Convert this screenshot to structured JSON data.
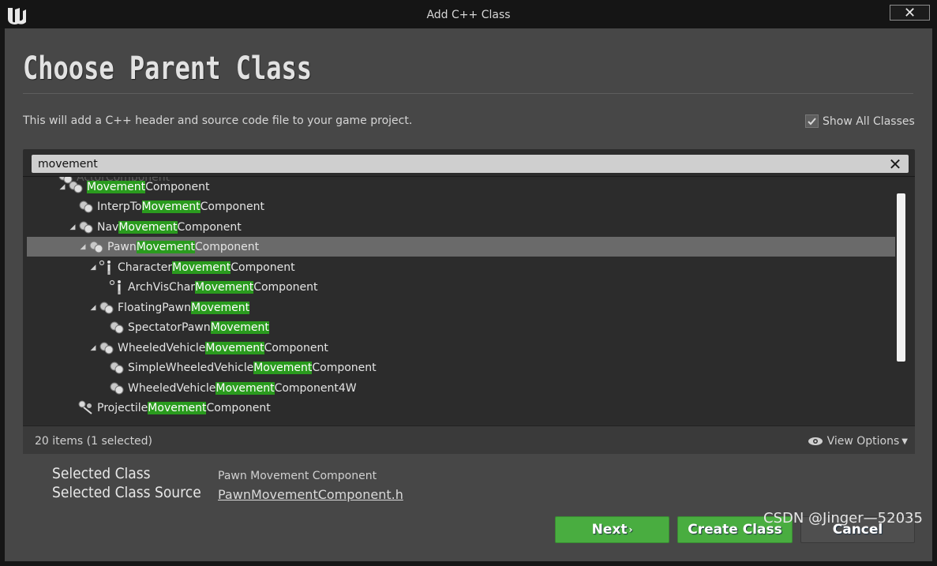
{
  "window": {
    "title": "Add C++ Class",
    "close_glyph": "✕"
  },
  "header": {
    "title": "Choose Parent Class",
    "subtitle": "This will add a C++ header and source code file to your game project.",
    "show_all_label": "Show All Classes",
    "show_all_checked": true
  },
  "search": {
    "value": "movement",
    "clear_glyph": "✕"
  },
  "tree": {
    "rows": [
      {
        "pre": "ActorComponent",
        "hl": "",
        "post": "",
        "icon": "component-icon",
        "expander": "none"
      },
      {
        "pre": "",
        "hl": "Movement",
        "post": "Component",
        "icon": "component-icon",
        "expander": "expanded"
      },
      {
        "pre": "InterpTo",
        "hl": "Movement",
        "post": "Component",
        "icon": "component-icon",
        "expander": "none"
      },
      {
        "pre": "Nav",
        "hl": "Movement",
        "post": "Component",
        "icon": "component-icon",
        "expander": "expanded"
      },
      {
        "pre": "Pawn",
        "hl": "Movement",
        "post": "Component",
        "icon": "component-icon",
        "expander": "expanded",
        "selected": true
      },
      {
        "pre": "Character",
        "hl": "Movement",
        "post": "Component",
        "icon": "character-icon",
        "expander": "expanded"
      },
      {
        "pre": "ArchVisChar",
        "hl": "Movement",
        "post": "Component",
        "icon": "character-icon",
        "expander": "none"
      },
      {
        "pre": "FloatingPawn",
        "hl": "Movement",
        "post": "",
        "icon": "component-icon",
        "expander": "expanded"
      },
      {
        "pre": "SpectatorPawn",
        "hl": "Movement",
        "post": "",
        "icon": "component-icon",
        "expander": "none"
      },
      {
        "pre": "WheeledVehicle",
        "hl": "Movement",
        "post": "Component",
        "icon": "component-icon",
        "expander": "expanded"
      },
      {
        "pre": "SimpleWheeledVehicle",
        "hl": "Movement",
        "post": "Component",
        "icon": "component-icon",
        "expander": "none"
      },
      {
        "pre": "WheeledVehicle",
        "hl": "Movement",
        "post": "Component4W",
        "icon": "component-icon",
        "expander": "none"
      },
      {
        "pre": "Projectile",
        "hl": "Movement",
        "post": "Component",
        "icon": "projectile-icon",
        "expander": "none"
      }
    ]
  },
  "footer": {
    "count": "20 items (1 selected)",
    "view_options": "View Options"
  },
  "selection": {
    "class_label": "Selected Class",
    "class_value": "Pawn Movement Component",
    "source_label": "Selected Class Source",
    "source_value": "PawnMovementComponent.h"
  },
  "buttons": {
    "next": "Next",
    "create": "Create Class",
    "cancel": "Cancel"
  },
  "watermark": "CSDN @Jinger—52035"
}
